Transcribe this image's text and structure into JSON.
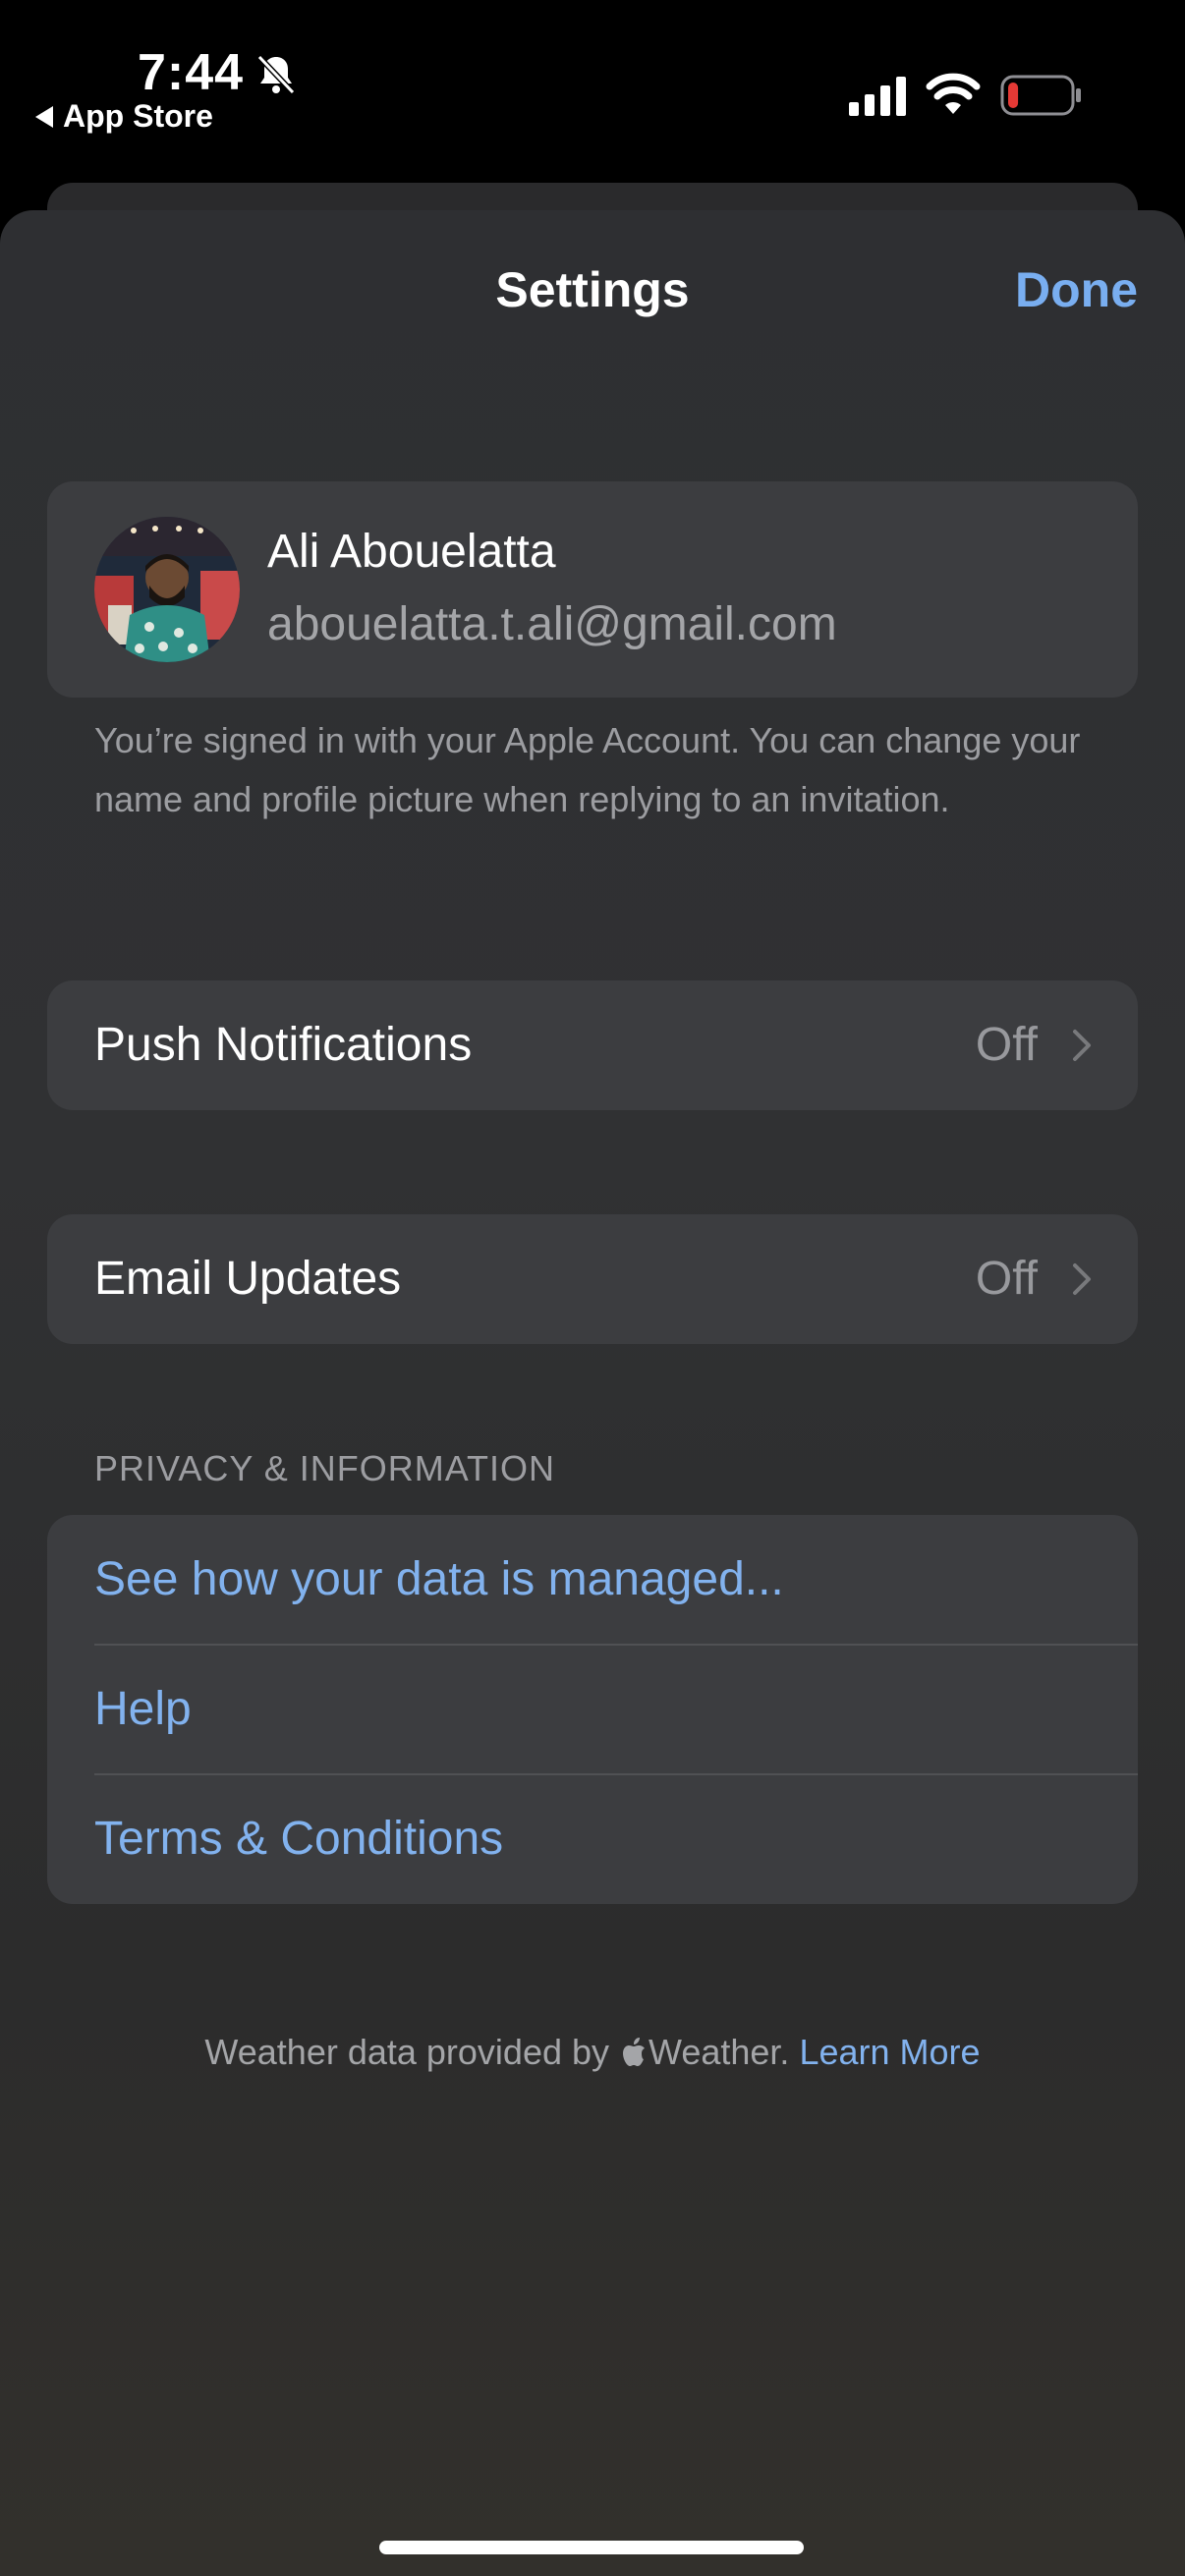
{
  "status_bar": {
    "time": "7:44",
    "back_app": "App Store",
    "icons": [
      "bell-slash-icon",
      "cellular-signal-icon",
      "wifi-icon",
      "battery-low-icon"
    ],
    "battery_level": 0.12
  },
  "header": {
    "title": "Settings",
    "done_label": "Done"
  },
  "account": {
    "name": "Ali Abouelatta",
    "email": "abouelatta.t.ali@gmail.com",
    "footnote": "You’re signed in with your Apple Account. You can change your name and profile picture when replying to an invitation."
  },
  "push_notifications": {
    "label": "Push Notifications",
    "value": "Off"
  },
  "email_updates": {
    "label": "Email Updates",
    "value": "Off"
  },
  "privacy": {
    "header": "PRIVACY & INFORMATION",
    "items": [
      {
        "label": "See how your data is managed..."
      },
      {
        "label": "Help"
      },
      {
        "label": "Terms & Conditions"
      }
    ]
  },
  "footer": {
    "prefix": "Weather data provided by ",
    "brand": "Weather.",
    "link": "Learn More"
  },
  "colors": {
    "accent": "#79aef0",
    "background": "#2e2f32",
    "card": "#3c3d40",
    "battery_low": "#e53935"
  }
}
